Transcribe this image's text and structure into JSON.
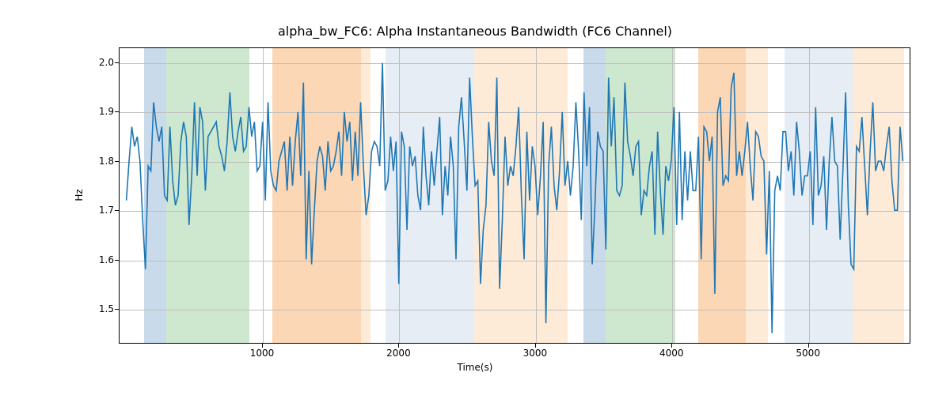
{
  "chart_data": {
    "type": "line",
    "title": "alpha_bw_FC6: Alpha Instantaneous Bandwidth (FC6 Channel)",
    "xlabel": "Time(s)",
    "ylabel": "Hz",
    "xlim": [
      -50,
      5750
    ],
    "ylim": [
      1.43,
      2.03
    ],
    "xticks": [
      1000,
      2000,
      3000,
      4000,
      5000
    ],
    "yticks": [
      1.5,
      1.6,
      1.7,
      1.8,
      1.9,
      2.0
    ],
    "line_color": "#1f77b4",
    "shaded_regions": [
      {
        "x0": 130,
        "x1": 290,
        "color": "#c9daea"
      },
      {
        "x0": 290,
        "x1": 900,
        "color": "#cde8cf"
      },
      {
        "x0": 1070,
        "x1": 1720,
        "color": "#fbd7b5"
      },
      {
        "x0": 1720,
        "x1": 1790,
        "color": "#fdebd8"
      },
      {
        "x0": 1900,
        "x1": 2040,
        "color": "#e6edf5"
      },
      {
        "x0": 2040,
        "x1": 2550,
        "color": "#e6edf5"
      },
      {
        "x0": 2550,
        "x1": 3230,
        "color": "#fdebd8"
      },
      {
        "x0": 3350,
        "x1": 3510,
        "color": "#c9daea"
      },
      {
        "x0": 3510,
        "x1": 4020,
        "color": "#cde8cf"
      },
      {
        "x0": 4190,
        "x1": 4540,
        "color": "#fbd7b5"
      },
      {
        "x0": 4540,
        "x1": 4700,
        "color": "#fdebd8"
      },
      {
        "x0": 4820,
        "x1": 5180,
        "color": "#e6edf5"
      },
      {
        "x0": 5180,
        "x1": 5320,
        "color": "#e6edf5"
      },
      {
        "x0": 5320,
        "x1": 5700,
        "color": "#fdebd8"
      }
    ],
    "series": [
      {
        "name": "alpha_bw_FC6",
        "x": [
          0,
          20,
          40,
          60,
          80,
          100,
          120,
          140,
          160,
          180,
          200,
          220,
          240,
          260,
          280,
          300,
          320,
          340,
          360,
          380,
          400,
          420,
          440,
          460,
          480,
          500,
          520,
          540,
          560,
          580,
          600,
          620,
          640,
          660,
          680,
          700,
          720,
          740,
          760,
          780,
          800,
          820,
          840,
          860,
          880,
          900,
          920,
          940,
          960,
          980,
          1000,
          1020,
          1040,
          1060,
          1080,
          1100,
          1120,
          1140,
          1160,
          1180,
          1200,
          1220,
          1240,
          1260,
          1280,
          1300,
          1320,
          1340,
          1360,
          1380,
          1400,
          1420,
          1440,
          1460,
          1480,
          1500,
          1520,
          1540,
          1560,
          1580,
          1600,
          1620,
          1640,
          1660,
          1680,
          1700,
          1720,
          1740,
          1760,
          1780,
          1800,
          1820,
          1840,
          1860,
          1880,
          1900,
          1920,
          1940,
          1960,
          1980,
          2000,
          2020,
          2040,
          2060,
          2080,
          2100,
          2120,
          2140,
          2160,
          2180,
          2200,
          2220,
          2240,
          2260,
          2280,
          2300,
          2320,
          2340,
          2360,
          2380,
          2400,
          2420,
          2440,
          2460,
          2480,
          2500,
          2520,
          2540,
          2560,
          2580,
          2600,
          2620,
          2640,
          2660,
          2680,
          2700,
          2720,
          2740,
          2760,
          2780,
          2800,
          2820,
          2840,
          2860,
          2880,
          2900,
          2920,
          2940,
          2960,
          2980,
          3000,
          3020,
          3040,
          3060,
          3080,
          3100,
          3120,
          3140,
          3160,
          3180,
          3200,
          3220,
          3240,
          3260,
          3280,
          3300,
          3320,
          3340,
          3360,
          3380,
          3400,
          3420,
          3440,
          3460,
          3480,
          3500,
          3520,
          3540,
          3560,
          3580,
          3600,
          3620,
          3640,
          3660,
          3680,
          3700,
          3720,
          3740,
          3760,
          3780,
          3800,
          3820,
          3840,
          3860,
          3880,
          3900,
          3920,
          3940,
          3960,
          3980,
          4000,
          4020,
          4040,
          4060,
          4080,
          4100,
          4120,
          4140,
          4160,
          4180,
          4200,
          4220,
          4240,
          4260,
          4280,
          4300,
          4320,
          4340,
          4360,
          4380,
          4400,
          4420,
          4440,
          4460,
          4480,
          4500,
          4520,
          4540,
          4560,
          4580,
          4600,
          4620,
          4640,
          4660,
          4680,
          4700,
          4720,
          4740,
          4760,
          4780,
          4800,
          4820,
          4840,
          4860,
          4880,
          4900,
          4920,
          4940,
          4960,
          4980,
          5000,
          5020,
          5040,
          5060,
          5080,
          5100,
          5120,
          5140,
          5160,
          5180,
          5200,
          5220,
          5240,
          5260,
          5280,
          5300,
          5320,
          5340,
          5360,
          5380,
          5400,
          5420,
          5440,
          5460,
          5480,
          5500,
          5520,
          5540,
          5560,
          5580,
          5600,
          5620,
          5640,
          5660,
          5680,
          5700
        ],
        "y": [
          1.72,
          1.8,
          1.87,
          1.83,
          1.85,
          1.8,
          1.68,
          1.58,
          1.79,
          1.78,
          1.92,
          1.87,
          1.84,
          1.87,
          1.73,
          1.72,
          1.87,
          1.76,
          1.71,
          1.73,
          1.84,
          1.88,
          1.85,
          1.67,
          1.77,
          1.92,
          1.77,
          1.91,
          1.88,
          1.74,
          1.85,
          1.86,
          1.87,
          1.88,
          1.83,
          1.81,
          1.78,
          1.84,
          1.94,
          1.85,
          1.82,
          1.86,
          1.89,
          1.82,
          1.83,
          1.91,
          1.85,
          1.88,
          1.78,
          1.79,
          1.88,
          1.72,
          1.92,
          1.78,
          1.75,
          1.74,
          1.8,
          1.82,
          1.84,
          1.74,
          1.85,
          1.75,
          1.84,
          1.9,
          1.77,
          1.96,
          1.6,
          1.78,
          1.59,
          1.7,
          1.8,
          1.83,
          1.81,
          1.74,
          1.84,
          1.78,
          1.79,
          1.82,
          1.86,
          1.77,
          1.9,
          1.84,
          1.88,
          1.76,
          1.86,
          1.77,
          1.92,
          1.79,
          1.69,
          1.73,
          1.82,
          1.84,
          1.83,
          1.79,
          2.0,
          1.74,
          1.76,
          1.85,
          1.78,
          1.84,
          1.55,
          1.86,
          1.83,
          1.66,
          1.83,
          1.79,
          1.81,
          1.73,
          1.7,
          1.87,
          1.77,
          1.71,
          1.82,
          1.75,
          1.82,
          1.89,
          1.69,
          1.79,
          1.73,
          1.85,
          1.79,
          1.6,
          1.87,
          1.93,
          1.84,
          1.74,
          1.97,
          1.85,
          1.75,
          1.76,
          1.55,
          1.66,
          1.71,
          1.88,
          1.8,
          1.77,
          1.97,
          1.54,
          1.68,
          1.85,
          1.75,
          1.79,
          1.77,
          1.83,
          1.91,
          1.73,
          1.6,
          1.86,
          1.72,
          1.83,
          1.79,
          1.69,
          1.77,
          1.88,
          1.47,
          1.79,
          1.87,
          1.75,
          1.7,
          1.78,
          1.9,
          1.75,
          1.8,
          1.73,
          1.79,
          1.92,
          1.82,
          1.68,
          1.94,
          1.79,
          1.91,
          1.59,
          1.71,
          1.86,
          1.83,
          1.82,
          1.62,
          1.97,
          1.83,
          1.93,
          1.74,
          1.73,
          1.75,
          1.96,
          1.84,
          1.81,
          1.77,
          1.83,
          1.84,
          1.69,
          1.74,
          1.73,
          1.79,
          1.82,
          1.65,
          1.86,
          1.74,
          1.65,
          1.79,
          1.76,
          1.8,
          1.91,
          1.67,
          1.9,
          1.68,
          1.82,
          1.72,
          1.82,
          1.74,
          1.74,
          1.85,
          1.6,
          1.87,
          1.86,
          1.8,
          1.85,
          1.53,
          1.9,
          1.93,
          1.75,
          1.77,
          1.76,
          1.95,
          1.98,
          1.77,
          1.82,
          1.77,
          1.82,
          1.88,
          1.79,
          1.72,
          1.86,
          1.85,
          1.81,
          1.8,
          1.61,
          1.78,
          1.45,
          1.74,
          1.77,
          1.74,
          1.86,
          1.86,
          1.78,
          1.82,
          1.73,
          1.88,
          1.82,
          1.73,
          1.77,
          1.77,
          1.82,
          1.67,
          1.91,
          1.73,
          1.75,
          1.81,
          1.66,
          1.8,
          1.89,
          1.8,
          1.79,
          1.64,
          1.78,
          1.94,
          1.71,
          1.59,
          1.58,
          1.83,
          1.82,
          1.89,
          1.79,
          1.69,
          1.82,
          1.92,
          1.78,
          1.8,
          1.8,
          1.78,
          1.83,
          1.87,
          1.76,
          1.7,
          1.7,
          1.87,
          1.8
        ]
      }
    ]
  }
}
